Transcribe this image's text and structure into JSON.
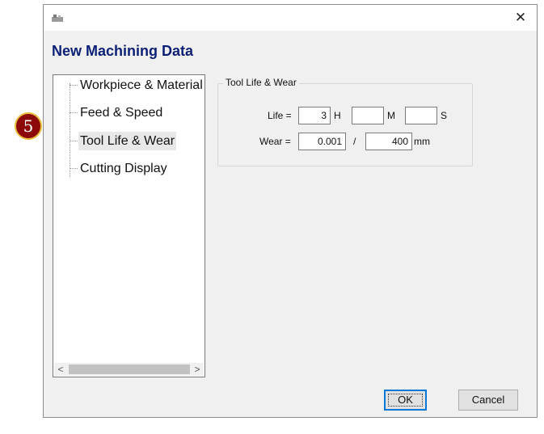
{
  "window": {
    "close_glyph": "✕",
    "icon": "app-icon"
  },
  "heading": "New Machining Data",
  "tree": {
    "items": [
      {
        "label": "Workpiece & Material",
        "selected": false
      },
      {
        "label": "Feed & Speed",
        "selected": false
      },
      {
        "label": "Tool Life & Wear",
        "selected": true
      },
      {
        "label": "Cutting Display",
        "selected": false
      }
    ],
    "scroll_left": "<",
    "scroll_right": ">"
  },
  "group": {
    "title": "Tool Life & Wear",
    "life_label": "Life =",
    "life_h_value": "3",
    "life_h_unit": "H",
    "life_m_value": "",
    "life_m_unit": "M",
    "life_s_value": "",
    "life_s_unit": "S",
    "wear_label": "Wear =",
    "wear_value": "0.001",
    "wear_sep": "/",
    "wear_length": "400",
    "wear_unit": "mm"
  },
  "buttons": {
    "ok": "OK",
    "cancel": "Cancel"
  },
  "annotation": {
    "number": "5"
  },
  "colors": {
    "heading": "#0a1f75",
    "badge_fill": "#8d0a0a",
    "badge_border": "#e8bd3a",
    "focus": "#0078d7"
  }
}
